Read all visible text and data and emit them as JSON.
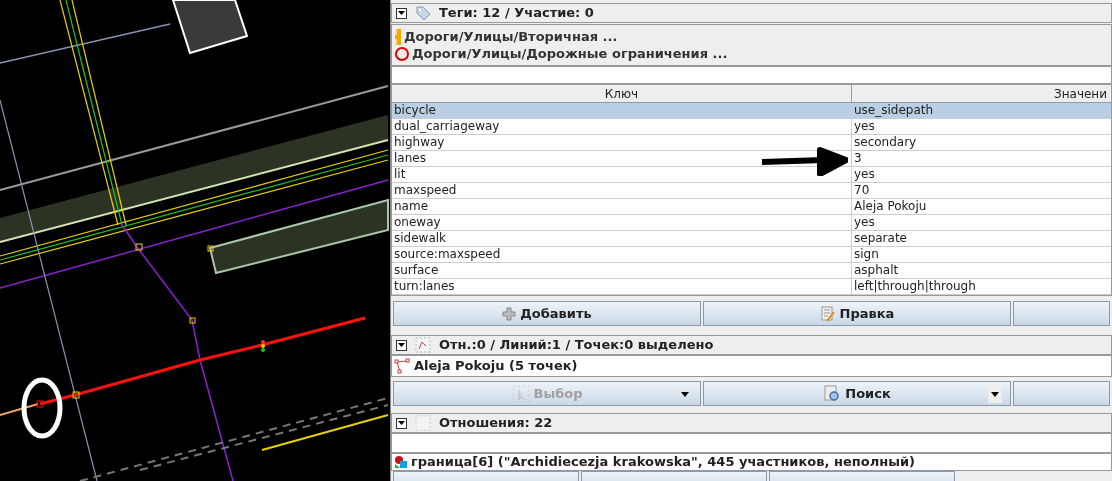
{
  "tags_panel": {
    "title": "Теги: 12 / Участие: 0",
    "expanded": true,
    "presets": [
      {
        "label": "Дороги/Улицы/Вторичная ...",
        "kind": "road"
      },
      {
        "label": "Дороги/Улицы/Дорожные ограничения ...",
        "kind": "restriction"
      }
    ],
    "table": {
      "columns": [
        "Ключ",
        "Значени"
      ],
      "rows": [
        {
          "key": "bicycle",
          "value": "use_sidepath",
          "selected": true
        },
        {
          "key": "dual_carriageway",
          "value": "yes",
          "selected": false
        },
        {
          "key": "highway",
          "value": "secondary",
          "selected": false
        },
        {
          "key": "lanes",
          "value": "3",
          "selected": false
        },
        {
          "key": "lit",
          "value": "yes",
          "selected": false
        },
        {
          "key": "maxspeed",
          "value": "70",
          "selected": false
        },
        {
          "key": "name",
          "value": "Aleja Pokoju",
          "selected": false
        },
        {
          "key": "oneway",
          "value": "yes",
          "selected": false
        },
        {
          "key": "sidewalk",
          "value": "separate",
          "selected": false
        },
        {
          "key": "source:maxspeed",
          "value": "sign",
          "selected": false
        },
        {
          "key": "surface",
          "value": "asphalt",
          "selected": false
        },
        {
          "key": "turn:lanes",
          "value": "left|through|through",
          "selected": false
        }
      ]
    },
    "buttons": [
      {
        "label": "Добавить",
        "kind": "plus"
      },
      {
        "label": "Правка",
        "kind": "edit"
      }
    ]
  },
  "selection_panel": {
    "title": "Отн.:0 / Линий:1 / Точек:0 выделено",
    "expanded": true,
    "items": [
      "Aleja Pokoju (5 точек)"
    ],
    "buttons": [
      {
        "label": "Выбор",
        "kind": "select",
        "disabled": true
      },
      {
        "label": "Поиск",
        "kind": "search",
        "disabled": false
      }
    ]
  },
  "relations_panel": {
    "title": "Отношения: 22",
    "expanded": true,
    "items": [
      "граница[6] (\"Archidiecezja krakowska\", 445 участников, неполный)"
    ]
  }
}
